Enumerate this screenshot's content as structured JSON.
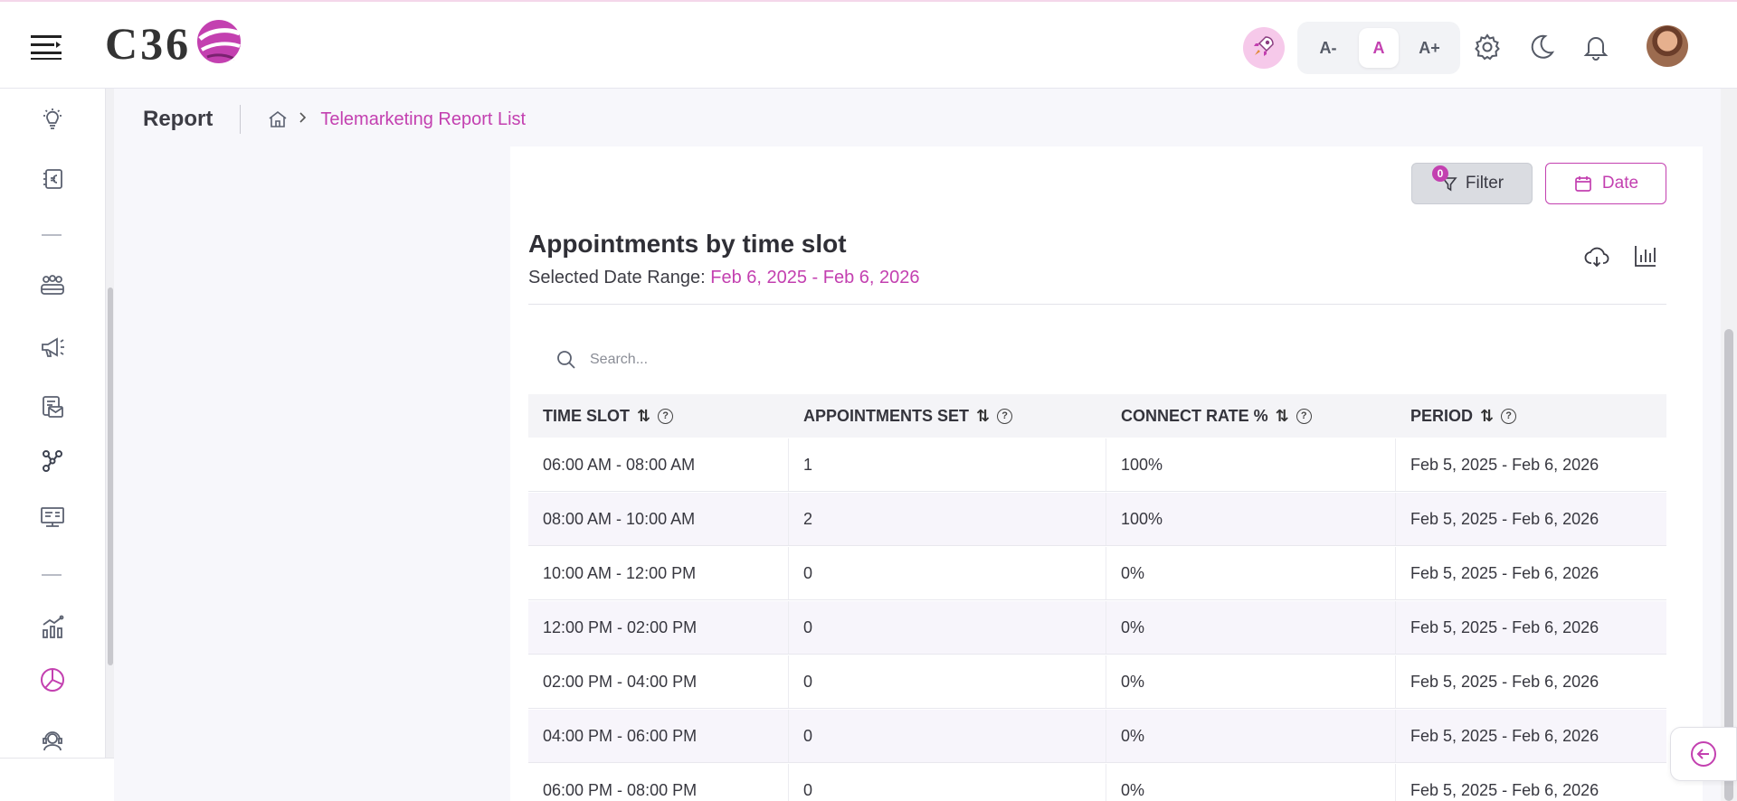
{
  "brand": {
    "logo_text": "C36"
  },
  "header": {
    "font_decrease": "A-",
    "font_normal": "A",
    "font_increase": "A+",
    "accent_color": "#c340b0"
  },
  "sidebar": {
    "items": [
      {
        "icon": "lightbulb-icon"
      },
      {
        "icon": "euro-receipt-icon"
      },
      {
        "icon": "team-icon"
      },
      {
        "icon": "megaphone-icon"
      },
      {
        "icon": "mail-document-icon"
      },
      {
        "icon": "network-icon"
      },
      {
        "icon": "presentation-board-icon"
      },
      {
        "icon": "analytics-chart-icon"
      },
      {
        "icon": "pie-chart-icon",
        "active": true
      },
      {
        "icon": "support-agent-icon"
      }
    ]
  },
  "breadcrumb": {
    "title": "Report",
    "current": "Telemarketing Report List"
  },
  "toolbar": {
    "filter_label": "Filter",
    "filter_count": "0",
    "date_label": "Date"
  },
  "report": {
    "title": "Appointments by time slot",
    "range_label": "Selected Date Range:",
    "range_value": "Feb 6, 2025 - Feb 6, 2026"
  },
  "search": {
    "placeholder": "Search..."
  },
  "table": {
    "headers": [
      "TIME SLOT",
      "APPOINTMENTS SET",
      "CONNECT RATE %",
      "PERIOD"
    ],
    "rows": [
      [
        "06:00 AM - 08:00 AM",
        "1",
        "100%",
        "Feb 5, 2025 - Feb 6, 2026"
      ],
      [
        "08:00 AM - 10:00 AM",
        "2",
        "100%",
        "Feb 5, 2025 - Feb 6, 2026"
      ],
      [
        "10:00 AM - 12:00 PM",
        "0",
        "0%",
        "Feb 5, 2025 - Feb 6, 2026"
      ],
      [
        "12:00 PM - 02:00 PM",
        "0",
        "0%",
        "Feb 5, 2025 - Feb 6, 2026"
      ],
      [
        "02:00 PM - 04:00 PM",
        "0",
        "0%",
        "Feb 5, 2025 - Feb 6, 2026"
      ],
      [
        "04:00 PM - 06:00 PM",
        "0",
        "0%",
        "Feb 5, 2025 - Feb 6, 2026"
      ],
      [
        "06:00 PM - 08:00 PM",
        "0",
        "0%",
        "Feb 5, 2025 - Feb 6, 2026"
      ]
    ]
  }
}
